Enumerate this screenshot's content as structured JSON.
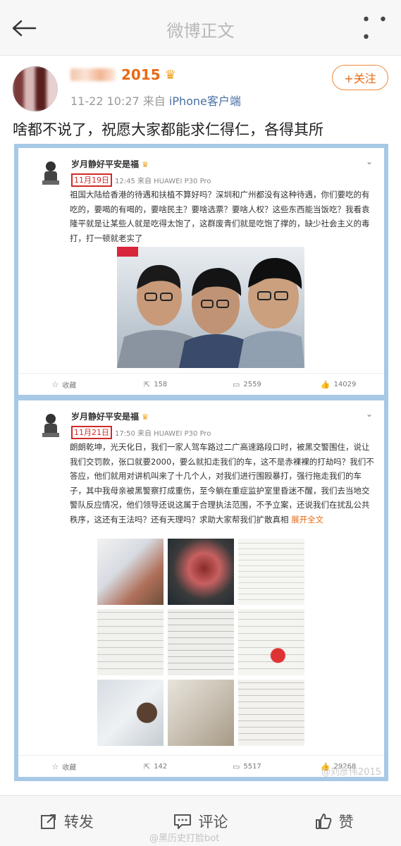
{
  "header": {
    "title": "微博正文"
  },
  "post": {
    "username": "2015",
    "time": "11-22 10:27",
    "source_prefix": "来自",
    "source": "iPhone客户端",
    "follow_label": "+关注",
    "content": "啥都不说了，祝愿大家都能求仁得仁，各得其所"
  },
  "card1": {
    "name": "岁月静好平安是福",
    "date": "11月19日",
    "meta": "12:45 来自 HUAWEI P30 Pro",
    "text": "祖国大陆给香港的待遇和扶植不算好吗？深圳和广州都没有这种待遇，你们要吃的有吃的，要喝的有喝的，要啥民主？要啥选票？要啥人权？这些东西能当饭吃？我看袁隆平就是让某些人就是吃得太饱了，这群废青们就是吃饱了撑的，缺少社会主义的毒打，打一顿就老实了",
    "actions": {
      "favorite": "收藏",
      "repost": "158",
      "comment": "2559",
      "like": "14029"
    }
  },
  "card2": {
    "name": "岁月静好平安是福",
    "date": "11月21日",
    "meta": "17:50 来自 HUAWEI P30 Pro",
    "text": "朗朗乾坤，光天化日，我们一家人驾车路过二广高速路段口时，被黑交警围住，说让我们交罚款，张口就要2000，要么就扣走我们的车，这不是赤裸裸的打劫吗？我们不答应，他们就用对讲机叫来了十几个人，对我们进行围殴暴打，强行拖走我们的车子，其中我母亲被黑警察打成重伤，至今躺在重症监护室里昏迷不醒，我们去当地交警队反应情况，他们领导还说这属于合理执法范围，不予立案，还说我们在扰乱公共秩序，这还有王法吗？还有天理吗？求助大家帮我们扩散真相",
    "expand": "展开全文",
    "actions": {
      "favorite": "收藏",
      "repost": "142",
      "comment": "5517",
      "like": "29268"
    }
  },
  "watermark": "@刘彦伟2015",
  "bottom": {
    "repost": "转发",
    "comment": "评论",
    "like": "赞",
    "watermark": "@黑历史打脸bot"
  }
}
